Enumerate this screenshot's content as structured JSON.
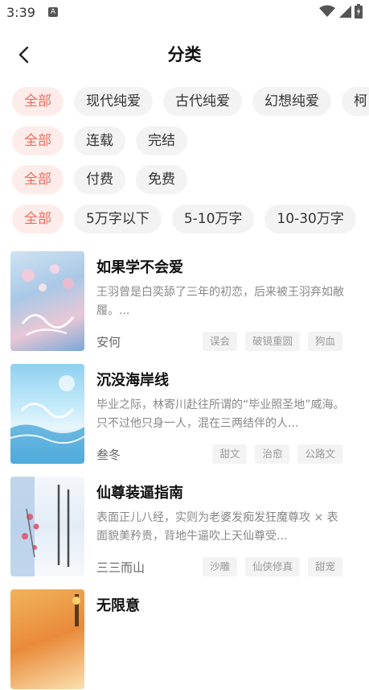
{
  "status": {
    "time": "3:39",
    "notif_letter": "A"
  },
  "header": {
    "title": "分类",
    "back_icon": "chevron-left-icon"
  },
  "filters": {
    "genre": [
      "全部",
      "现代纯爱",
      "古代纯爱",
      "幻想纯爱",
      "柯"
    ],
    "status": [
      "全部",
      "连载",
      "完结"
    ],
    "price": [
      "全部",
      "付费",
      "免费"
    ],
    "length": [
      "全部",
      "5万字以下",
      "5-10万字",
      "10-30万字"
    ]
  },
  "books": [
    {
      "title": "如果学不会爱",
      "desc": "王羽曾是白奕舔了三年的初恋，后来被王羽弃如敝履。...",
      "author": "安何",
      "tags": [
        "误会",
        "破镜重圆",
        "狗血"
      ]
    },
    {
      "title": "沉没海岸线",
      "desc": "毕业之际，林寄川赴往所谓的“毕业照圣地”威海。只不过他只身一人，混在三两结伴的人...",
      "author": "叁冬",
      "tags": [
        "甜文",
        "治愈",
        "公路文"
      ]
    },
    {
      "title": "仙尊装逼指南",
      "desc": "表面正儿八经，实则为老婆发痴发狂魔尊攻 × 表面貌美矜贵，背地牛逼吹上天仙尊受...",
      "author": "三三而山",
      "tags": [
        "沙雕",
        "仙侠修真",
        "甜宠"
      ]
    },
    {
      "title": "无限意",
      "desc": "",
      "author": "",
      "tags": []
    }
  ],
  "colors": {
    "accent": "#f26b5b",
    "accent_bg": "#fdecea",
    "chip_bg": "#f3f3f3"
  }
}
